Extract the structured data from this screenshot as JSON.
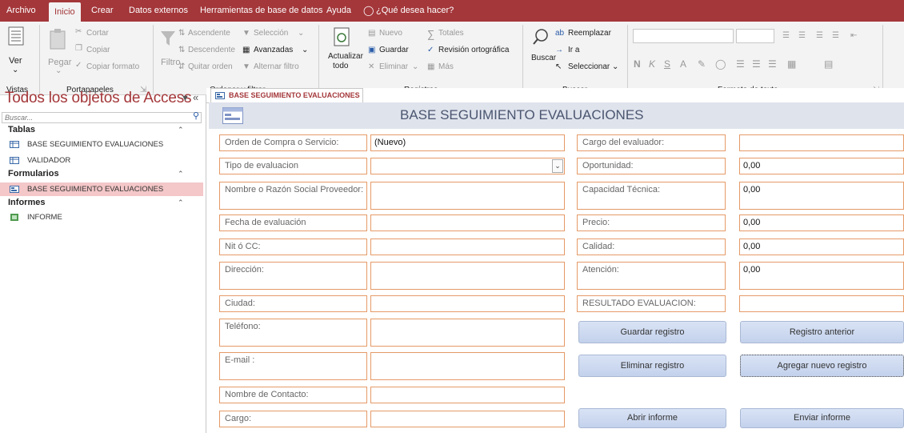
{
  "menu": {
    "items": [
      "Archivo",
      "Inicio",
      "Crear",
      "Datos externos",
      "Herramientas de base de datos",
      "Ayuda"
    ],
    "tell_me": "¿Qué desea hacer?"
  },
  "ribbon": {
    "view_label": "Ver",
    "paste_label": "Pegar",
    "cut_label": "Cortar",
    "copy_label": "Copiar",
    "copy_format_label": "Copiar formato",
    "filter_label": "Filtro",
    "ascending_label": "Ascendente",
    "descending_label": "Descendente",
    "remove_sort_label": "Quitar orden",
    "selection_label": "Selección",
    "advanced_label": "Avanzadas",
    "toggle_filter_label": "Alternar filtro",
    "refresh_label": "Actualizar",
    "refresh_all_label": "todo",
    "new_label": "Nuevo",
    "save_label": "Guardar",
    "delete_label": "Eliminar",
    "totals_label": "Totales",
    "spelling_label": "Revisión ortográfica",
    "more_label": "Más",
    "find_label": "Buscar",
    "replace_label": "Reemplazar",
    "goto_label": "Ir a",
    "select_label": "Seleccionar",
    "bold": "N",
    "italic": "K",
    "underline": "S",
    "groups": [
      "Vistas",
      "Portapapeles",
      "Ordenar y filtrar",
      "Registros",
      "Buscar",
      "Formato de texto"
    ]
  },
  "nav": {
    "title": "Todos los objetos de Access",
    "search_placeholder": "Buscar...",
    "sections": [
      {
        "name": "Tablas",
        "items": [
          "BASE SEGUIMIENTO EVALUACIONES",
          "VALIDADOR"
        ]
      },
      {
        "name": "Formularios",
        "items": [
          "BASE SEGUIMIENTO EVALUACIONES"
        ]
      },
      {
        "name": "Informes",
        "items": [
          "INFORME"
        ]
      }
    ]
  },
  "tab": {
    "label": "BASE SEGUIMIENTO EVALUACIONES"
  },
  "form": {
    "title": "BASE SEGUIMIENTO EVALUACIONES",
    "left_fields": [
      {
        "label": "Orden de Compra o Servicio:",
        "value": "(Nuevo)"
      },
      {
        "label": "Tipo de evaluacion",
        "value": ""
      },
      {
        "label": "Nombre o Razón Social Proveedor:",
        "value": ""
      },
      {
        "label": "Fecha de evaluación",
        "value": ""
      },
      {
        "label": "Nit ó CC:",
        "value": ""
      },
      {
        "label": "Dirección:",
        "value": ""
      },
      {
        "label": "Ciudad:",
        "value": ""
      },
      {
        "label": "Teléfono:",
        "value": ""
      },
      {
        "label": "E-mail :",
        "value": ""
      },
      {
        "label": "Nombre de Contacto:",
        "value": ""
      },
      {
        "label": "Cargo:",
        "value": ""
      }
    ],
    "right_fields": [
      {
        "label": "Cargo del evaluador:",
        "value": ""
      },
      {
        "label": "Oportunidad:",
        "value": "0,00"
      },
      {
        "label": "Capacidad Técnica:",
        "value": "0,00"
      },
      {
        "label": "Precio:",
        "value": "0,00"
      },
      {
        "label": "Calidad:",
        "value": "0,00"
      },
      {
        "label": "Atención:",
        "value": "0,00"
      },
      {
        "label": "RESULTADO EVALUACION:",
        "value": ""
      }
    ],
    "buttons": {
      "save_record": "Guardar registro",
      "prev_record": "Registro anterior",
      "delete_record": "Eliminar registro",
      "add_record": "Agregar nuevo registro",
      "open_report": "Abrir informe",
      "send_report": "Enviar informe"
    }
  },
  "colors": {
    "accent": "#a4373a",
    "field_border": "#e59a68",
    "header_bg": "#dfe3ec",
    "selected_nav": "#f4c7c8"
  }
}
